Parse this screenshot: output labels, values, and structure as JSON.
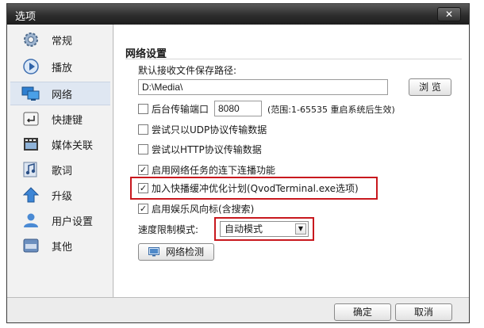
{
  "window": {
    "title": "选项",
    "close_label": "✕"
  },
  "sidebar": {
    "items": [
      {
        "label": "常规",
        "icon": "gear-icon"
      },
      {
        "label": "播放",
        "icon": "play-icon"
      },
      {
        "label": "网络",
        "icon": "network-icon",
        "active": true
      },
      {
        "label": "快捷键",
        "icon": "enter-key-icon"
      },
      {
        "label": "媒体关联",
        "icon": "film-icon"
      },
      {
        "label": "歌词",
        "icon": "music-note-icon"
      },
      {
        "label": "升级",
        "icon": "up-arrow-icon"
      },
      {
        "label": "用户设置",
        "icon": "user-icon"
      },
      {
        "label": "其他",
        "icon": "etc-icon"
      }
    ]
  },
  "network": {
    "section_title": "网络设置",
    "save_path_label": "默认接收文件保存路径:",
    "save_path_value": "D:\\Media\\",
    "browse_label": "浏 览",
    "bg_port": {
      "label": "后台传输端口",
      "checked": false,
      "value": "8080",
      "hint": "(范围:1-65535 重启系统后生效)"
    },
    "udp_only": {
      "label": "尝试只以UDP协议传输数据",
      "checked": false
    },
    "http_only": {
      "label": "尝试以HTTP协议传输数据",
      "checked": false
    },
    "continuous": {
      "label": "启用网络任务的连下连播功能",
      "checked": true
    },
    "buffer_plan": {
      "label": "加入快播缓冲优化计划(QvodTerminal.exe选项)",
      "checked": true
    },
    "entertain": {
      "label": "启用娱乐风向标(含搜索)",
      "checked": true
    },
    "speed_limit": {
      "label": "速度限制模式:",
      "value": "自动模式"
    },
    "detect_label": "网络检测"
  },
  "footer": {
    "ok_label": "确定",
    "cancel_label": "取消"
  },
  "colors": {
    "highlight": "#c8181e",
    "titlebar": "#2d2d2d",
    "active_nav": "#dfe7f2"
  }
}
